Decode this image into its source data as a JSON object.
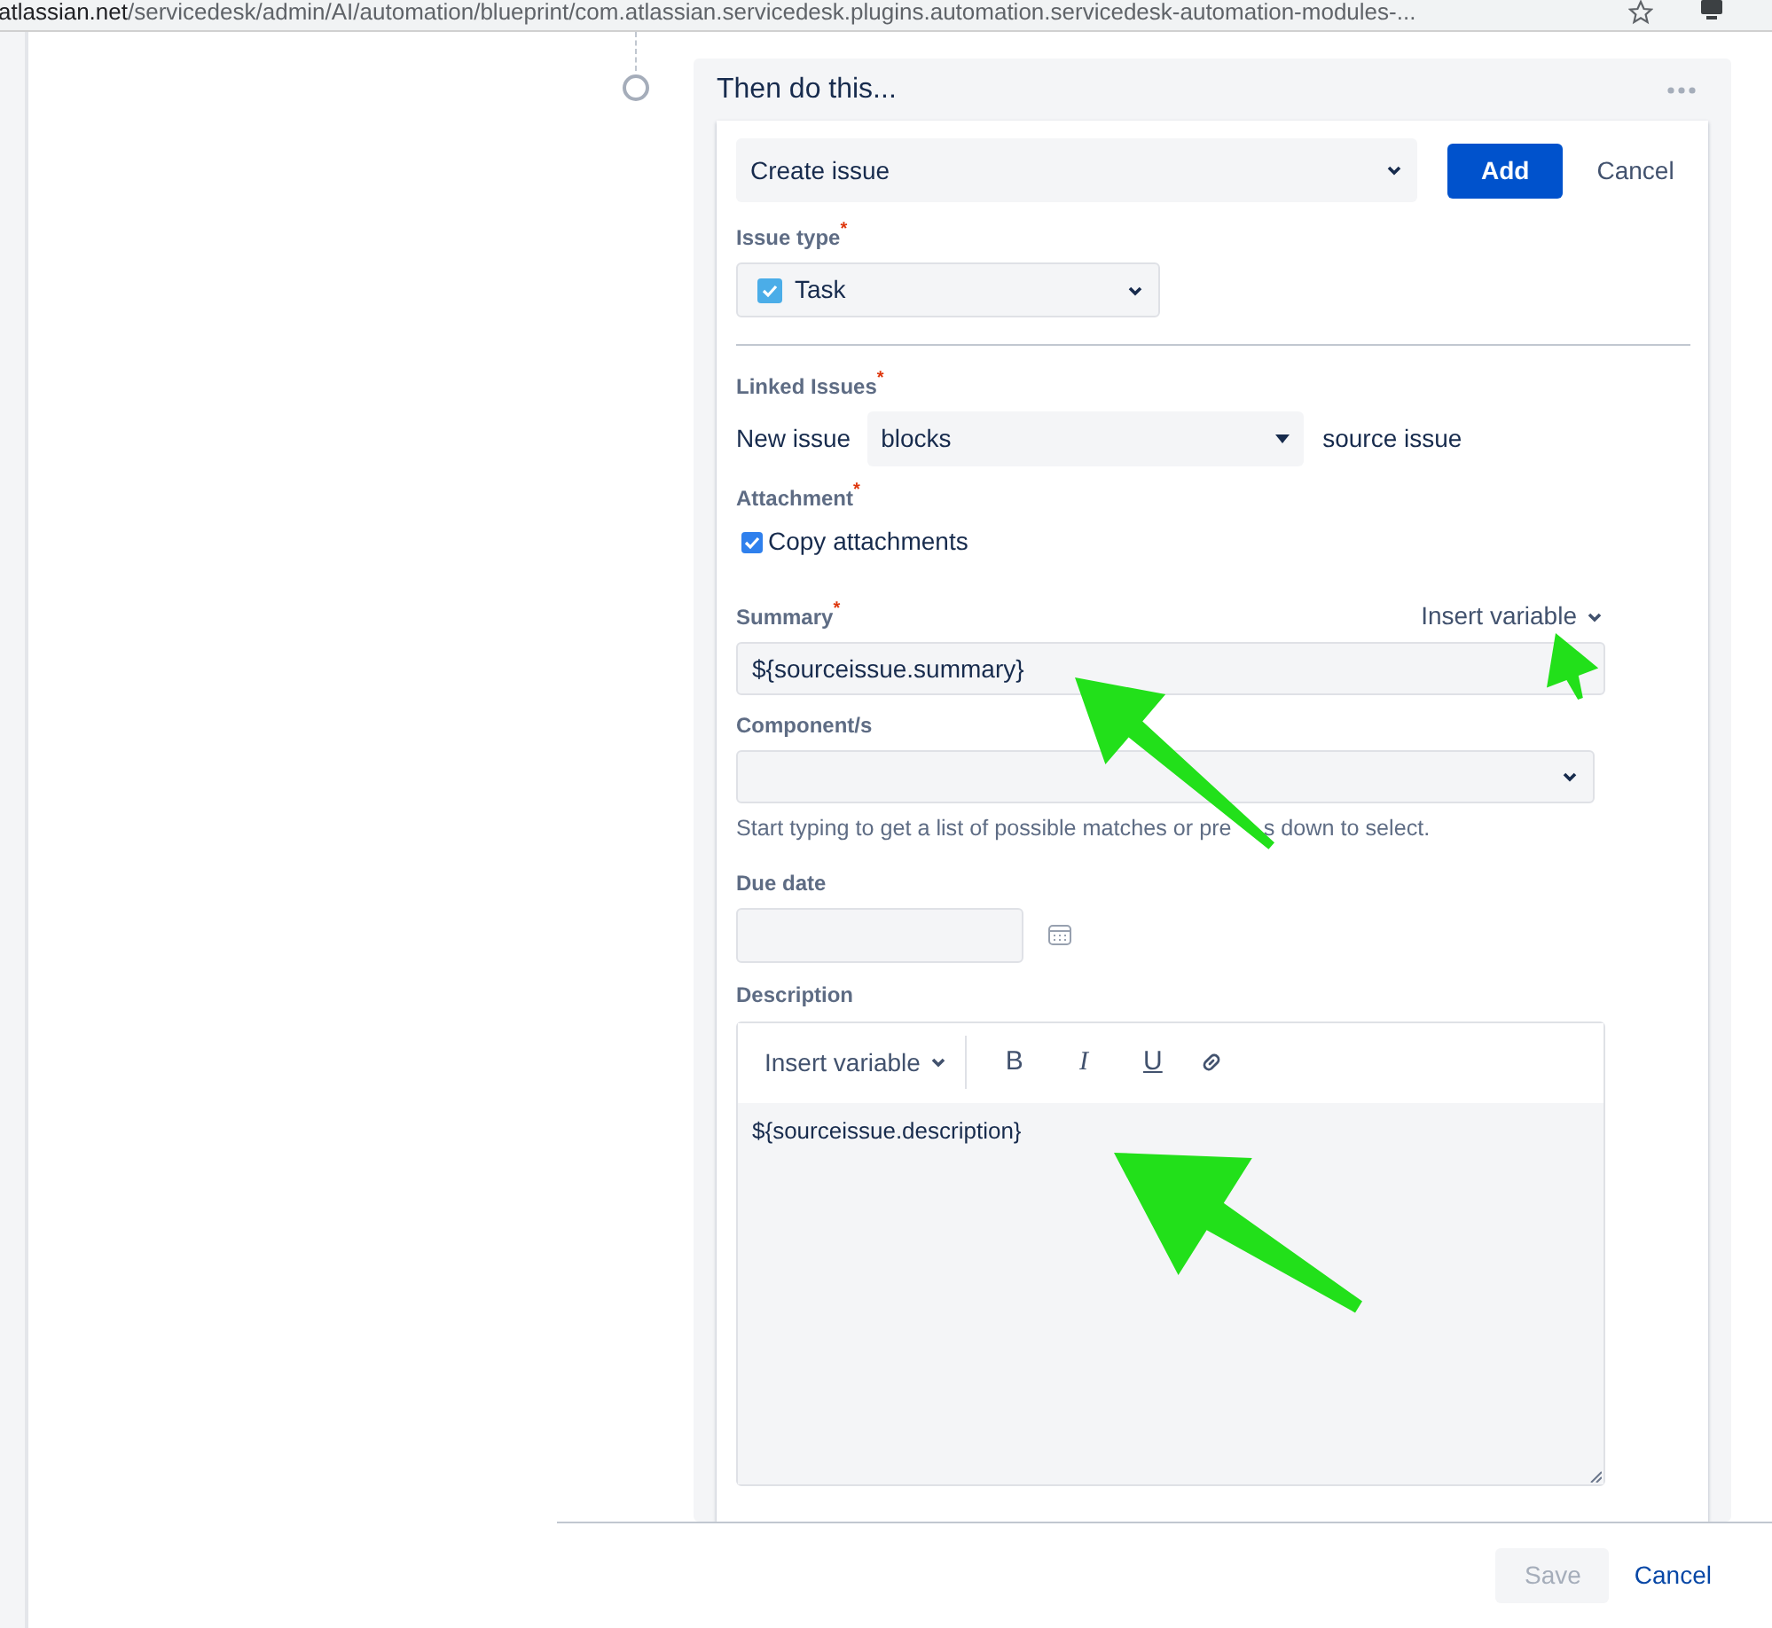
{
  "browser": {
    "url_host": "atlassian.net",
    "url_path": "/servicedesk/admin/AI/automation/blueprint/com.atlassian.servicedesk.plugins.automation.servicedesk-automation-modules-..."
  },
  "action": {
    "title": "Then do this...",
    "action_select": "Create issue",
    "buttons": [
      {
        "label": "Add",
        "kind": "primary"
      },
      {
        "label": "Cancel",
        "kind": "link"
      }
    ]
  },
  "issue_type": {
    "label": "Issue type",
    "required_mark": "*",
    "value": "Task"
  },
  "linked_issues": {
    "label": "Linked Issues",
    "required_mark": "*",
    "prefix": "New issue",
    "value": "blocks",
    "suffix": "source issue"
  },
  "attachment": {
    "label": "Attachment",
    "required_mark": "*",
    "option": "Copy attachments",
    "checked": true
  },
  "summary": {
    "label": "Summary",
    "required_mark": "*",
    "insert_variable": "Insert variable",
    "value": "${sourceissue.summary}"
  },
  "components": {
    "label": "Component/s",
    "help_before": "Start typing to get a list of possible matches or pre",
    "help_after": "s down to select."
  },
  "due_date": {
    "label": "Due date"
  },
  "description": {
    "label": "Description",
    "insert_variable": "Insert variable",
    "toolbar": [
      {
        "label": "B",
        "kind": "bold"
      },
      {
        "label": "I",
        "kind": "italic"
      },
      {
        "label": "U",
        "kind": "underline"
      }
    ],
    "value": "${sourceissue.description}"
  },
  "footer": {
    "buttons": [
      {
        "label": "Save",
        "disabled": true
      },
      {
        "label": "Cancel",
        "disabled": false
      }
    ]
  }
}
